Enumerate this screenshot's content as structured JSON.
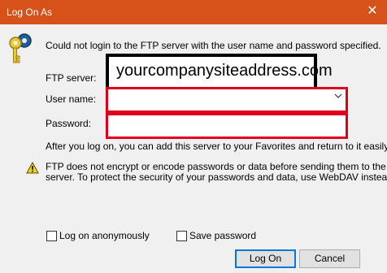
{
  "window": {
    "title": "Log On As",
    "close_glyph": "✕"
  },
  "message": "Could not login to the FTP server with the user name and password specified.",
  "labels": {
    "ftp_server": "FTP server:",
    "user_name": "User name:",
    "password": "Password:"
  },
  "fields": {
    "ftp_server_value": "yourcompanysiteaddress.com",
    "user_name_value": "",
    "password_value": ""
  },
  "after_logon": "After you log on, you can add this server to your Favorites and return to it easily.",
  "warning": {
    "line1": "FTP does not encrypt or encode passwords or data before sending them to the",
    "line2": "server.  To protect the security of your passwords and data, use WebDAV instead."
  },
  "checkboxes": {
    "anonymous": {
      "label": "Log on anonymously",
      "checked": false
    },
    "save_password": {
      "label": "Save password",
      "checked": false
    }
  },
  "buttons": {
    "logon": "Log On",
    "cancel": "Cancel"
  },
  "colors": {
    "titlebar": "#d6521a",
    "highlight": "#e0001b",
    "default_button_border": "#0078d7"
  },
  "icons": {
    "key": "key-icon",
    "warning": "warning-icon",
    "dropdown": "chevron-down-icon"
  }
}
